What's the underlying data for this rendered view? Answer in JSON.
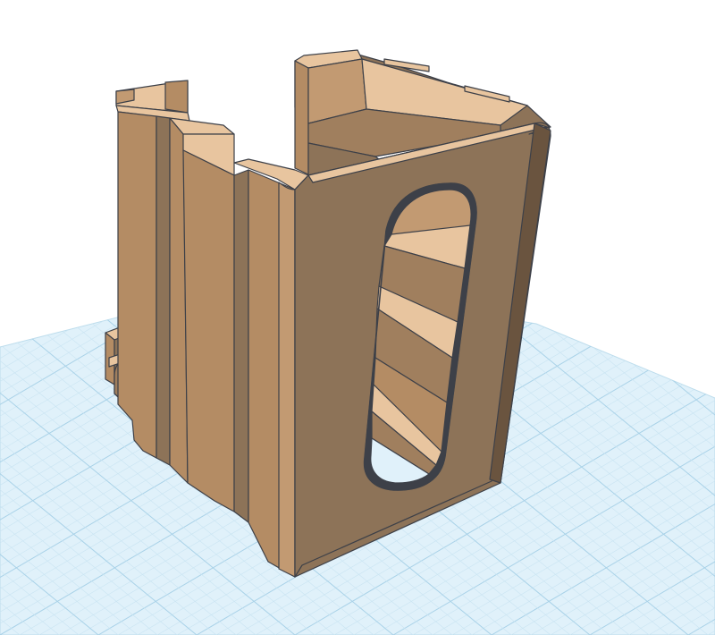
{
  "viewport": {
    "background_color": "#ffffff",
    "workplane_color": "#e0f1fa",
    "grid_minor_color": "#c9e4f2",
    "grid_major_color": "#a9d2e8"
  },
  "model": {
    "object_type": "3d-printed-bracket",
    "colors": {
      "top": "#e8c59f",
      "front": "#b48c64",
      "right": "#8d7358",
      "dark": "#6a543f",
      "edge": "#3d4048"
    }
  }
}
